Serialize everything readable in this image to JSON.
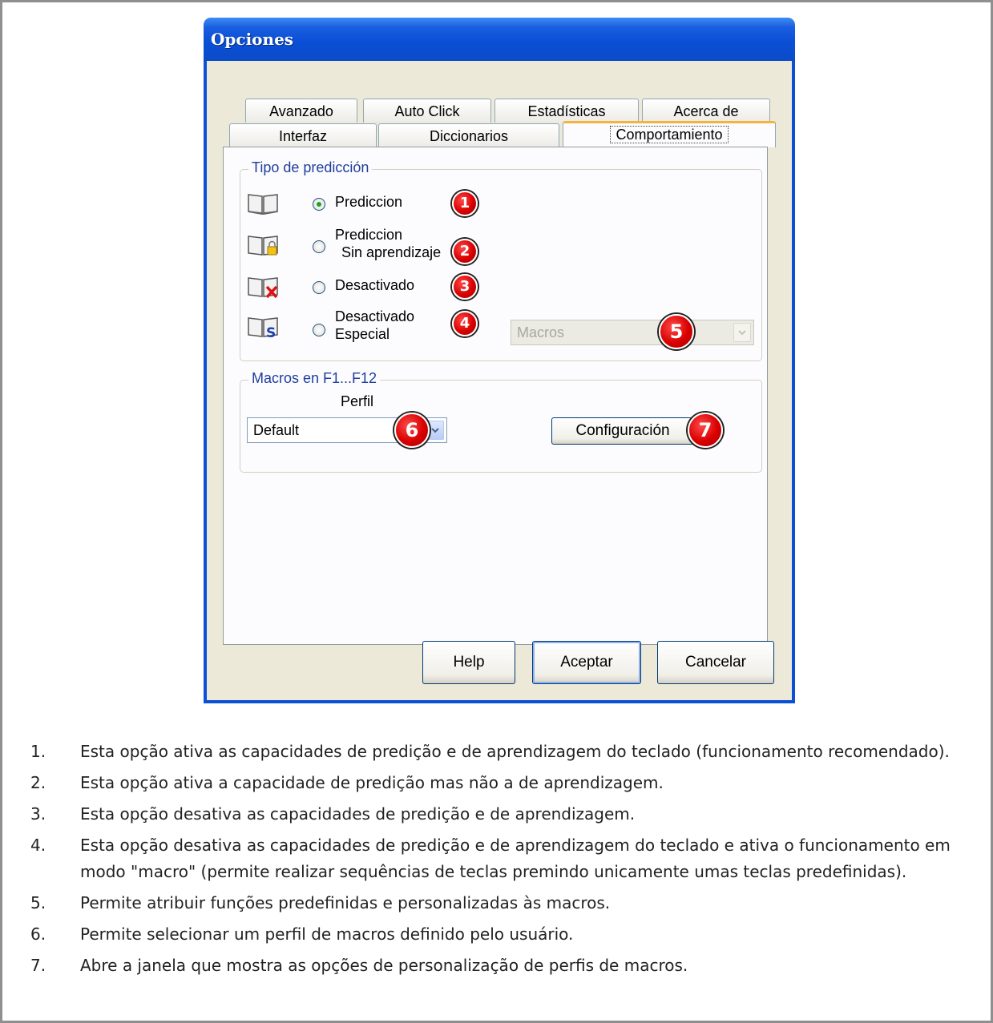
{
  "dialog": {
    "title": "Opciones",
    "tabs_row1": [
      "Avanzado",
      "Auto Click",
      "Estadísticas",
      "Acerca de"
    ],
    "tabs_row2": [
      "Interfaz",
      "Diccionarios",
      "Comportamiento"
    ],
    "active_tab": "Comportamiento",
    "prediction_group": {
      "label": "Tipo de predicción",
      "options": [
        {
          "line1": "Prediccion",
          "line2": "",
          "badge": "1",
          "selected": true,
          "icon": "book-icon"
        },
        {
          "line1": "Prediccion",
          "line2": "Sin aprendizaje",
          "badge": "2",
          "selected": false,
          "icon": "book-lock-icon"
        },
        {
          "line1": "Desactivado",
          "line2": "",
          "badge": "3",
          "selected": false,
          "icon": "book-disabled-icon"
        },
        {
          "line1": "Desactivado",
          "line2": "Especial",
          "badge": "4",
          "selected": false,
          "icon": "book-special-icon"
        }
      ],
      "macros_select": {
        "value": "Macros",
        "badge": "5"
      }
    },
    "macros_group": {
      "label": "Macros en F1...F12",
      "profile_label": "Perfil",
      "profile_value": "Default",
      "profile_badge": "6",
      "config_button": "Configuración",
      "config_badge": "7"
    },
    "buttons": {
      "help": "Help",
      "accept": "Aceptar",
      "cancel": "Cancelar"
    }
  },
  "notes": [
    {
      "num": "1.",
      "text": "Esta opção ativa as capacidades de predição e de aprendizagem do teclado (funcionamento recomendado)."
    },
    {
      "num": "2.",
      "text": "Esta opção ativa a capacidade de predição mas não a de aprendizagem."
    },
    {
      "num": "3.",
      "text": "Esta opção desativa as capacidades de predição e de aprendizagem."
    },
    {
      "num": "4.",
      "text": "Esta opção desativa as capacidades de predição e de aprendizagem do teclado e ativa o funcionamento em modo \"macro\" (permite realizar sequências de teclas premindo unicamente umas teclas predefinidas)."
    },
    {
      "num": "5.",
      "text": "Permite atribuir funções predefinidas e personalizadas às macros."
    },
    {
      "num": "6.",
      "text": "Permite selecionar um perfil de macros definido pelo usuário."
    },
    {
      "num": "7.",
      "text": "Abre a janela que mostra as opções de personalização de perfis de macros."
    }
  ],
  "colors": {
    "titlebar": "#0a4fd6",
    "dialog_bg": "#ece9d8",
    "badge": "#d90000",
    "group_label": "#1f3e9c",
    "tab_highlight": "#f3b43c"
  }
}
